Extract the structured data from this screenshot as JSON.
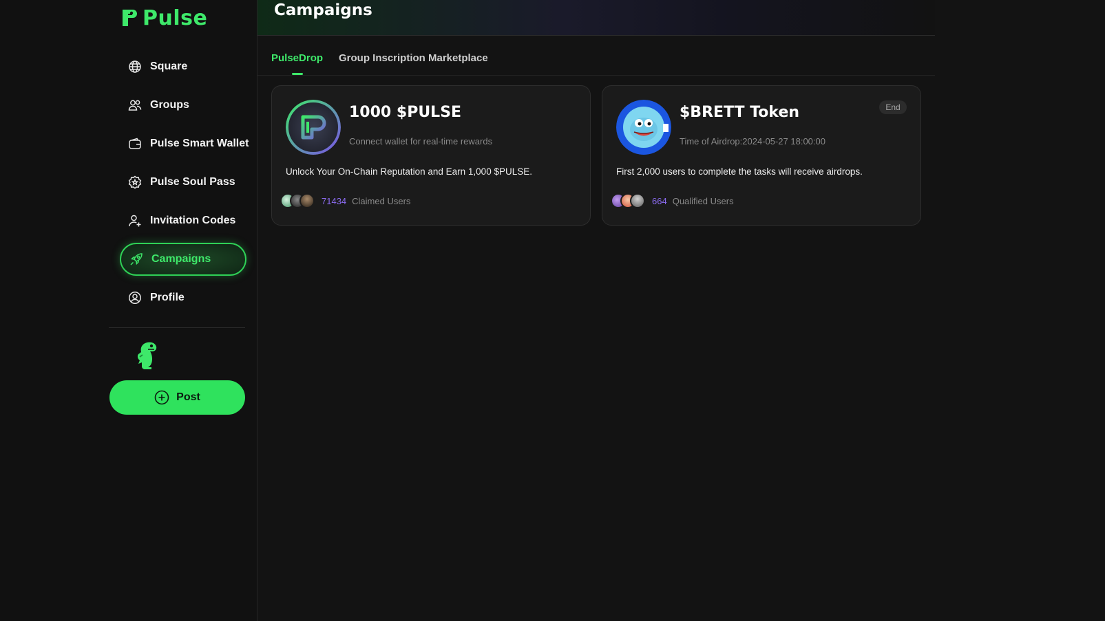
{
  "brand": {
    "name": "Pulse",
    "color": "#3ee86a"
  },
  "sidebar": {
    "items": [
      {
        "label": "Square",
        "icon": "globe-icon"
      },
      {
        "label": "Groups",
        "icon": "users-icon"
      },
      {
        "label": "Pulse Smart Wallet",
        "icon": "wallet-icon"
      },
      {
        "label": "Pulse Soul Pass",
        "icon": "badge-star-icon"
      },
      {
        "label": "Invitation Codes",
        "icon": "user-plus-icon"
      },
      {
        "label": "Campaigns",
        "icon": "rocket-icon",
        "active": true
      },
      {
        "label": "Profile",
        "icon": "user-circle-icon"
      }
    ],
    "post_label": "Post"
  },
  "header": {
    "title": "Campaigns"
  },
  "tabs": [
    {
      "label": "PulseDrop",
      "active": true
    },
    {
      "label": "Group Inscription Marketplace",
      "active": false
    }
  ],
  "campaigns": [
    {
      "title": "1000 $PULSE",
      "subtitle": "Connect wallet for real-time rewards",
      "description": "Unlock Your On-Chain Reputation and Earn 1,000 $PULSE.",
      "count": "71434",
      "count_label": "Claimed Users",
      "badge": ""
    },
    {
      "title": "$BRETT Token",
      "subtitle": "Time of Airdrop:2024-05-27 18:00:00",
      "description": "First 2,000 users to complete the tasks will receive airdrops.",
      "count": "664",
      "count_label": "Qualified Users",
      "badge": "End"
    }
  ],
  "colors": {
    "accent": "#3ee86a",
    "count": "#8c6cf2",
    "background": "#131313",
    "card": "#1b1b1b"
  }
}
